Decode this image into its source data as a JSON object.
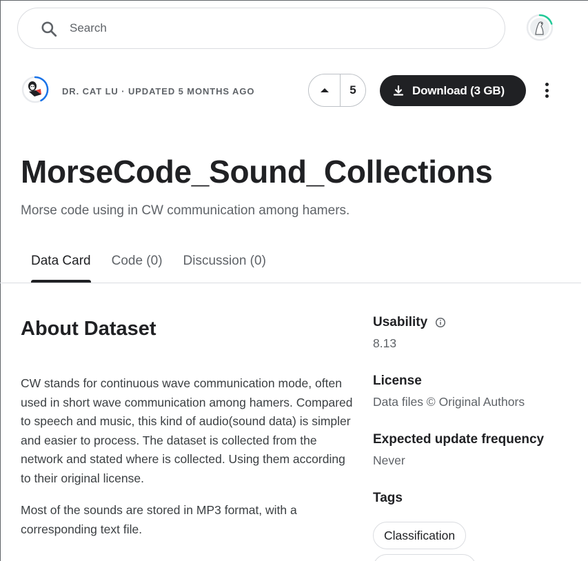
{
  "search": {
    "placeholder": "Search"
  },
  "header": {
    "meta": "Dr. Cat Lu · Updated 5 months ago",
    "vote_count": "5",
    "download_label": "Download (3 GB)"
  },
  "dataset": {
    "title": "MorseCode_Sound_Collections",
    "subtitle": "Morse code using in CW communication among hamers."
  },
  "tabs": [
    {
      "label": "Data Card",
      "active": true
    },
    {
      "label": "Code (0)"
    },
    {
      "label": "Discussion (0)"
    }
  ],
  "about": {
    "heading": "About Dataset",
    "paragraphs": [
      "CW stands for continuous wave communication mode, often used in short wave communication among hamers. Compared to speech and music, this kind of audio(sound data) is simpler and easier to process. The dataset is collected from the network and stated where is collected. Using them according to their original license.",
      "Most of the sounds are stored in MP3 format, with a corresponding text file."
    ]
  },
  "sidebar": {
    "usability": {
      "label": "Usability",
      "value": "8.13"
    },
    "license": {
      "label": "License",
      "value": "Data files © Original Authors"
    },
    "update_frequency": {
      "label": "Expected update frequency",
      "value": "Never"
    },
    "tags": {
      "label": "Tags",
      "items": [
        "Classification"
      ]
    }
  },
  "colors": {
    "primary_text": "#202124",
    "secondary_text": "#5f6368",
    "download_bg": "#202124",
    "progress_ring": "#1a73e8",
    "user_ring": "#20c997"
  },
  "icons": {
    "search": "search-icon",
    "upvote": "upvote-arrow-icon",
    "download": "download-icon",
    "more": "more-vertical-icon",
    "info": "info-icon"
  }
}
